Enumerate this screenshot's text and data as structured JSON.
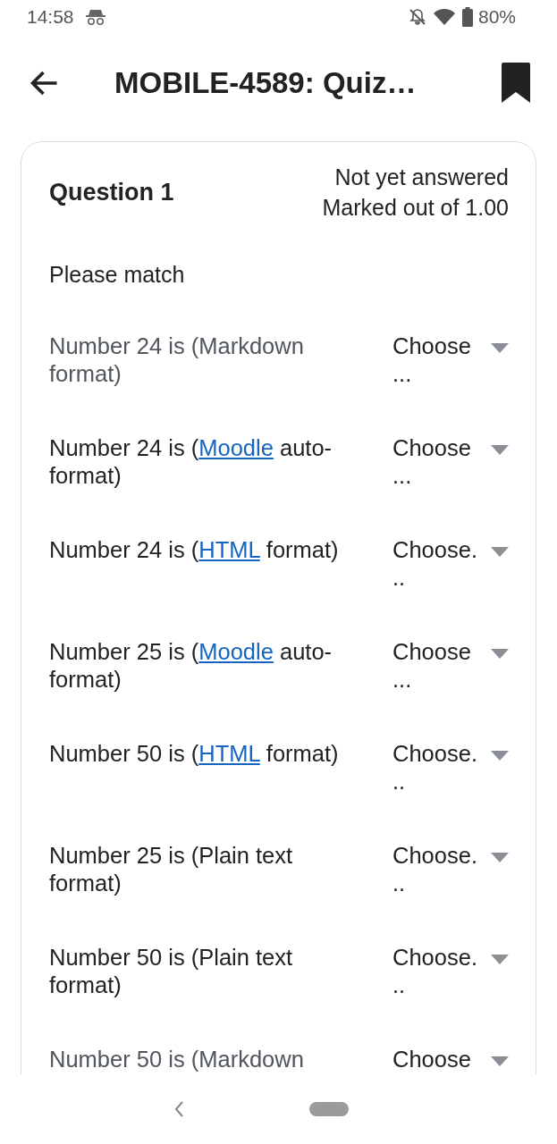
{
  "status_bar": {
    "time": "14:58",
    "battery": "80%"
  },
  "header": {
    "title": "MOBILE-4589: Quiz…"
  },
  "question": {
    "title": "Question 1",
    "state": "Not yet answered",
    "marks": "Marked out of 1.00",
    "prompt": "Please match",
    "items": [
      {
        "greyed": true,
        "label": [
          {
            "text": "Number 24 is (Markdown format)",
            "link": false
          }
        ],
        "select": "Choose ..."
      },
      {
        "greyed": false,
        "label": [
          {
            "text": "Number 24 is (",
            "link": false
          },
          {
            "text": "Moodle",
            "link": true
          },
          {
            "text": " auto-format)",
            "link": false
          }
        ],
        "select": "Choose ..."
      },
      {
        "greyed": false,
        "label": [
          {
            "text": "Number 24 is (",
            "link": false
          },
          {
            "text": "HTML",
            "link": true
          },
          {
            "text": " format)",
            "link": false
          }
        ],
        "select": "Choose..."
      },
      {
        "greyed": false,
        "label": [
          {
            "text": "Number 25 is (",
            "link": false
          },
          {
            "text": "Moodle",
            "link": true
          },
          {
            "text": " auto-format)",
            "link": false
          }
        ],
        "select": "Choose ..."
      },
      {
        "greyed": false,
        "label": [
          {
            "text": "Number 50 is (",
            "link": false
          },
          {
            "text": "HTML",
            "link": true
          },
          {
            "text": " format)",
            "link": false
          }
        ],
        "select": "Choose..."
      },
      {
        "greyed": false,
        "label": [
          {
            "text": "Number 25 is (Plain text format)",
            "link": false
          }
        ],
        "select": "Choose..."
      },
      {
        "greyed": false,
        "label": [
          {
            "text": "Number 50 is (Plain text format)",
            "link": false
          }
        ],
        "select": "Choose..."
      },
      {
        "greyed": true,
        "label": [
          {
            "text": "Number 50 is (Markdown",
            "link": false
          }
        ],
        "select": "Choose"
      }
    ]
  }
}
